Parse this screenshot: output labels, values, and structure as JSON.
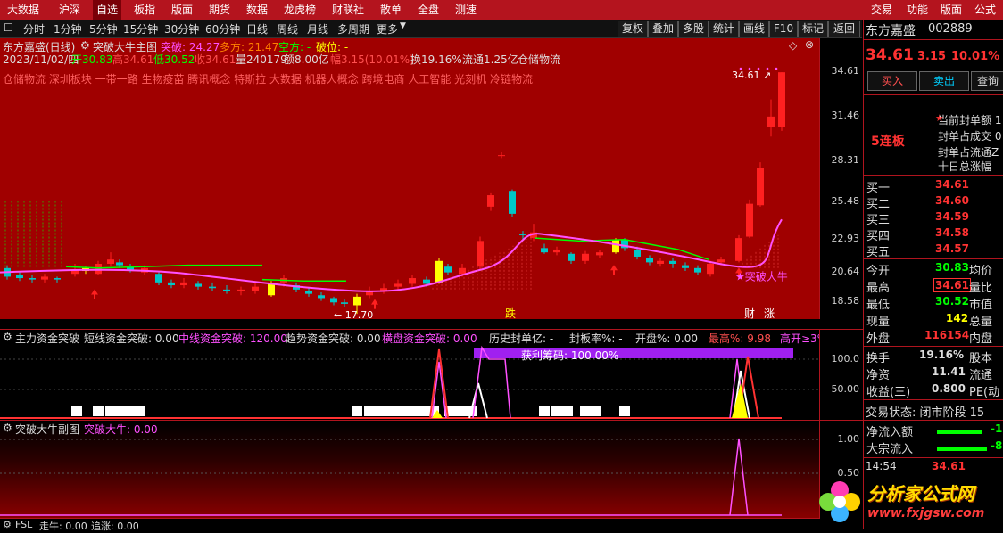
{
  "top_menu": [
    "大数据",
    "沪深",
    "自选",
    "板指",
    "版面",
    "期货",
    "数据",
    "龙虎榜",
    "财联社",
    "散单",
    "全盘",
    "测速"
  ],
  "top_menu_active": 2,
  "top_right_menu": [
    "交易",
    "功能",
    "版面",
    "公式"
  ],
  "toolbar": {
    "periods": [
      "分时",
      "1分钟",
      "5分钟",
      "15分钟",
      "30分钟",
      "60分钟",
      "日线",
      "周线",
      "月线",
      "多周期",
      "更多"
    ],
    "buttons": [
      "复权",
      "叠加",
      "多股",
      "统计",
      "画线",
      "F10",
      "标记",
      "返回"
    ]
  },
  "chart_header": {
    "title": "东方嘉盛(日线)",
    "indicator": "突破大牛主图",
    "breakout": "突破: 24.27",
    "bull": "多方: 21.47",
    "bear": "空方: -",
    "break_level": "破位: -"
  },
  "quote_line": {
    "date": "2023/11/02/四",
    "open": "开30.83",
    "high": "高34.61",
    "low": "低30.52",
    "close": "收34.61",
    "volume": "量240179",
    "amount": "额8.00亿",
    "change": "幅3.15(10.01%)",
    "turnover": "换19.16%",
    "float": "流通1.25亿",
    "sector": "仓储物流"
  },
  "concept_tags": "仓储物流 深圳板块 一带一路 生物疫苗 腾讯概念 特斯拉 大数据 机器人概念 跨境电商 人工智能 光刻机 冷链物流",
  "price_axis": [
    "34.61",
    "31.46",
    "28.31",
    "25.48",
    "22.93",
    "20.64",
    "18.58"
  ],
  "annotations": {
    "high_label": "34.61",
    "low_label": "17.70",
    "breakout_label": "★突破大牛",
    "fall_marker": "跌",
    "fin_marker": "财",
    "rise_marker": "涨"
  },
  "sub1": {
    "title": "主力资金突破",
    "short": "短线资金突破: 0.00",
    "mid": "中线资金突破: 120.00",
    "trend": "趋势资金突破: 0.00",
    "sideways": "横盘资金突破: 0.00",
    "hist_seal": "历史封单亿: -",
    "seal_rate": "封板率%: -",
    "open_rate": "开盘%: 0.00",
    "max_pct": "最高%: 9.98",
    "high_open": "高开≥3%",
    "profit_chips": "获利筹码: 100.00%",
    "axis": [
      "100.0",
      "50.00"
    ]
  },
  "sub2": {
    "title": "突破大牛副图",
    "value": "突破大牛: 0.00",
    "axis": [
      "1.00",
      "0.50"
    ]
  },
  "sub3": {
    "title": "FSL",
    "value1": "走牛: 0.00",
    "value2": "追涨: 0.00"
  },
  "right_panel": {
    "name": "东方嘉盛",
    "code": "002889",
    "price": "34.61",
    "change": "3.15",
    "pct": "10.01%",
    "buy_btn": "买入",
    "sell_btn": "卖出",
    "query_btn": "查询",
    "limit_board": "5连板",
    "limit_rows": [
      "当前封单额 1",
      "封单占成交 0",
      "封单占流通Z",
      "十日总涨幅"
    ],
    "bids": [
      {
        "label": "买一",
        "price": "34.61"
      },
      {
        "label": "买二",
        "price": "34.60"
      },
      {
        "label": "买三",
        "price": "34.59"
      },
      {
        "label": "买四",
        "price": "34.58"
      },
      {
        "label": "买五",
        "price": "34.57"
      }
    ],
    "stats": [
      {
        "label": "今开",
        "value": "30.83",
        "label2": "均价"
      },
      {
        "label": "最高",
        "value": "34.61",
        "label2": "量比"
      },
      {
        "label": "最低",
        "value": "30.52",
        "label2": "市值"
      },
      {
        "label": "现量",
        "value": "142",
        "label2": "总量"
      },
      {
        "label": "外盘",
        "value": "116154",
        "label2": "内盘"
      }
    ],
    "fin": [
      {
        "label": "换手",
        "value": "19.16%",
        "label2": "股本"
      },
      {
        "label": "净资",
        "value": "11.41",
        "label2": "流通"
      },
      {
        "label": "收益(三)",
        "value": "0.800",
        "label2": "PE(动"
      }
    ],
    "trade_status": "交易状态: 闭市阶段 15",
    "flows": [
      {
        "label": "净流入额",
        "value": "-1"
      },
      {
        "label": "大宗流入",
        "value": "-8"
      }
    ],
    "last_time": "14:54",
    "last_price": "34.61"
  },
  "watermark": {
    "brand": "分析家公式网",
    "url": "www.fxjgsw.com"
  },
  "colors": {
    "up": "#ff3232",
    "down": "#00d2d2",
    "menu": "#b4141e",
    "pink": "#ff50ff",
    "green": "#00ff00",
    "yellow": "#ffff00"
  }
}
